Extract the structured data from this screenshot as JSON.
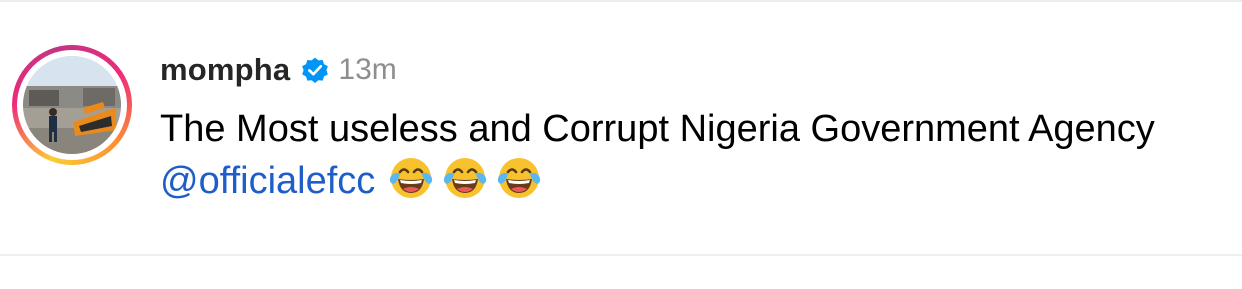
{
  "post": {
    "username": "mompha",
    "verified_icon": "verified-badge-icon",
    "timestamp": "13m",
    "caption_text": "The Most useless and Corrupt Nigeria Government Agency ",
    "mention": "@officialefcc",
    "emojis": [
      "face-with-tears-of-joy-icon",
      "face-with-tears-of-joy-icon",
      "face-with-tears-of-joy-icon"
    ]
  },
  "colors": {
    "username": "#262626",
    "timestamp": "#8e8e8e",
    "mention": "#1e5ec8",
    "verified": "#0095f6",
    "story_ring": [
      "#f9ce34",
      "#ee2a7b",
      "#c13584"
    ]
  }
}
